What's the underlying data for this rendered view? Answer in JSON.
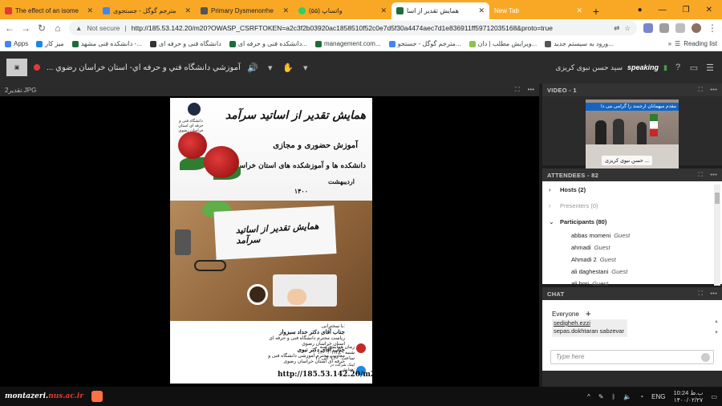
{
  "browser": {
    "tabs": [
      {
        "title": "The effect of an isome",
        "color": "#e53935",
        "active": false
      },
      {
        "title": "مترجم گوگل - جستجوی",
        "color": "#4285f4",
        "active": false
      },
      {
        "title": "Primary Dysmenorrhe",
        "color": "#555555",
        "active": false
      },
      {
        "title": "(۵۵) واتساپ",
        "color": "#25d366",
        "active": false
      },
      {
        "title": "همایش تقدیر از اسا",
        "color": "#1a6e3a",
        "active": true
      },
      {
        "title": "New Tab",
        "color": "",
        "active": false
      }
    ],
    "security": "Not secure",
    "url": "http://185.53.142.20/m20?OWASP_CSRFTOKEN=a2c3f2b03920ac1858510f52c0e7d5f30a4474aec7d1e836911ff59712035168&proto=true",
    "bookmarks": [
      {
        "label": "Apps",
        "color": "#4285f4"
      },
      {
        "label": "میز کار",
        "color": "#1e88e5"
      },
      {
        "label": "دانشکده فنی مشهد -...",
        "color": "#1a6e3a"
      },
      {
        "label": "دانشگاه فنی و حرفه ای",
        "color": "#333333"
      },
      {
        "label": "دانشکده فنی و حرفه ای...",
        "color": "#1a6e3a"
      },
      {
        "label": "management.com...",
        "color": "#1a6e3a"
      },
      {
        "label": "مترجم گوگل - جستجو...",
        "color": "#4285f4"
      },
      {
        "label": "ویرایش مطلب | دان...",
        "color": "#8bc34a"
      },
      {
        "label": "ورود به سیستم جدید...",
        "color": "#555555"
      }
    ],
    "reading_list": "Reading list"
  },
  "connect": {
    "meeting_title": "... آموزشي دانشگاه فني و حرفه اي- استان خراسان رضوي",
    "speaking_name": "سید حسن نبوی کریزی",
    "speaking_label": "speaking",
    "share_pod_title": "تقدیر2.JPG",
    "video_pod_title": "VIDEO - 1",
    "video_banner": "مقدم میهمانان ارجمند را گرامی می دا",
    "video_nametag": "حسن نبوی کریزی ...",
    "attendees_title": "ATTENDEES - 82",
    "groups": [
      {
        "label": "Hosts (2)",
        "expanded": false,
        "dim": false
      },
      {
        "label": "Presenters (0)",
        "expanded": false,
        "dim": true
      },
      {
        "label": "Participants (80)",
        "expanded": true,
        "dim": false
      }
    ],
    "participants": [
      {
        "name": "abbas momeni",
        "role": "Guest"
      },
      {
        "name": "ahmadi",
        "role": "Guest"
      },
      {
        "name": "Ahmadi 2",
        "role": "Guest"
      },
      {
        "name": "ali daghestani",
        "role": "Guest"
      },
      {
        "name": "ali hori",
        "role": "Guest"
      }
    ],
    "chat_title": "CHAT",
    "chat_tab": "Everyone",
    "chat_sender": "sedigheh.ezzi",
    "chat_message": "sepas.dokhtaran sabzevar",
    "chat_placeholder": "Type here"
  },
  "poster": {
    "title": "همایش تقدیر از اساتید سرآمد",
    "line2": "آموزش حضوری و مجازی",
    "line3": "دانشکده ها و آموزشکده های استان خراسان رضوی",
    "month": "اردیبهشت",
    "year": "۱۴۰۰",
    "uni_name": "دانشگاه فنی و حرفه ای استان خراسان رضوی",
    "paper_title": "همایش تقدیر از اساتید سرآمد",
    "guests_heading": "با سخنرانی:",
    "guest1": "جناب آقای دکتر حداد سبزوار",
    "guest1_role": "ریاست محترم دانشگاه فنی و حرفه ای استان خراسان رضوی",
    "guest2": "جناب آقای دکتر نبوی",
    "guest2_role": "معاونت محترم آموزشی دانشگاه فنی و حرفه ای استان خراسان رضوی",
    "schedule": "زمان همایش: سه شنبه - ۱۴۰۰/۰۲/۲۸ ساعت: ۹:۳۰ الی ۱۰",
    "link_label": "لینک شرکت در همایش:",
    "link": "http://185.53.142.20/m20"
  },
  "taskbar": {
    "watermark_prefix": "montazeri.",
    "watermark_domain": "nus.ac.ir",
    "lang": "ENG",
    "time": "10:24 ب.ظ",
    "date": "۱۴۰۰/۰۲/۲۷"
  }
}
